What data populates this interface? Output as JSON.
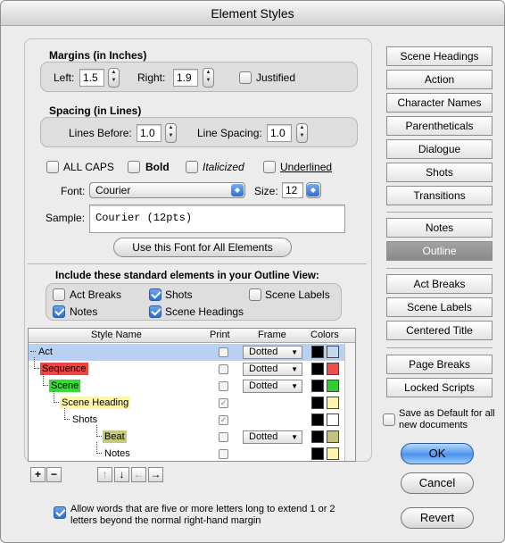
{
  "window": {
    "title": "Element Styles"
  },
  "margins": {
    "title": "Margins (in Inches)",
    "left_label": "Left:",
    "left_value": "1.5",
    "right_label": "Right:",
    "right_value": "1.9",
    "justified_label": "Justified",
    "justified_checked": false
  },
  "spacing": {
    "title": "Spacing (in Lines)",
    "before_label": "Lines Before:",
    "before_value": "1.0",
    "line_label": "Line Spacing:",
    "line_value": "1.0"
  },
  "styles": {
    "all_caps": "ALL CAPS",
    "bold": "Bold",
    "italic": "Italicized",
    "underline": "Underlined"
  },
  "font": {
    "label": "Font:",
    "value": "Courier",
    "size_label": "Size:",
    "size_value": "12",
    "sample_label": "Sample:",
    "sample_value": "Courier (12pts)",
    "use_all_button": "Use this Font for All Elements"
  },
  "outline_view": {
    "title": "Include these standard elements in your Outline View:",
    "act_breaks": "Act Breaks",
    "shots": "Shots",
    "scene_labels": "Scene Labels",
    "notes": "Notes",
    "scene_headings": "Scene Headings"
  },
  "table": {
    "headers": {
      "name": "Style Name",
      "print": "Print",
      "frame": "Frame",
      "colors": "Colors"
    },
    "rows": [
      {
        "name": "Act",
        "frame": "Dotted",
        "bg": "#ffffff",
        "fg": "#000000",
        "swatch2": "#c7d6ef"
      },
      {
        "name": "Sequence",
        "frame": "Dotted",
        "bg": "#ee4444",
        "fg": "#000000",
        "swatch2": "#ee5050"
      },
      {
        "name": "Scene",
        "frame": "Dotted",
        "bg": "#33dd33",
        "fg": "#000000",
        "swatch2": "#33cc33"
      },
      {
        "name": "Scene Heading",
        "frame": "",
        "bg": "#fff5a8",
        "fg": "#000000",
        "swatch2": "#fff7a8"
      },
      {
        "name": "Shots",
        "frame": "",
        "bg": "#ffffff",
        "fg": "#000000",
        "swatch2": "#ffffff"
      },
      {
        "name": "Beat",
        "frame": "Dotted",
        "bg": "#c6c87a",
        "fg": "#000000",
        "swatch2": "#c2c47a"
      },
      {
        "name": "Notes",
        "frame": "",
        "bg": "#fff5a8",
        "fg": "#000000",
        "swatch2": "#fff7a8"
      }
    ],
    "add_label": "+",
    "remove_label": "−",
    "up_label": "↑",
    "down_label": "↓",
    "left_label": "←",
    "right_label": "→"
  },
  "elements": [
    "Scene Headings",
    "Action",
    "Character Names",
    "Parentheticals",
    "Dialogue",
    "Shots",
    "Transitions"
  ],
  "outline_buttons": [
    "Notes",
    "Outline"
  ],
  "structure_buttons": [
    "Act Breaks",
    "Scene Labels",
    "Centered Title"
  ],
  "page_buttons": [
    "Page Breaks",
    "Locked Scripts"
  ],
  "save_default": "Save as Default for all new documents",
  "ok": "OK",
  "cancel": "Cancel",
  "revert": "Revert",
  "allow_words": "Allow words that are five or more letters long to extend 1 or 2 letters beyond the normal right-hand margin",
  "colors": {
    "accent": "#2b6ed6",
    "selected_row": "#b8d0f2"
  }
}
